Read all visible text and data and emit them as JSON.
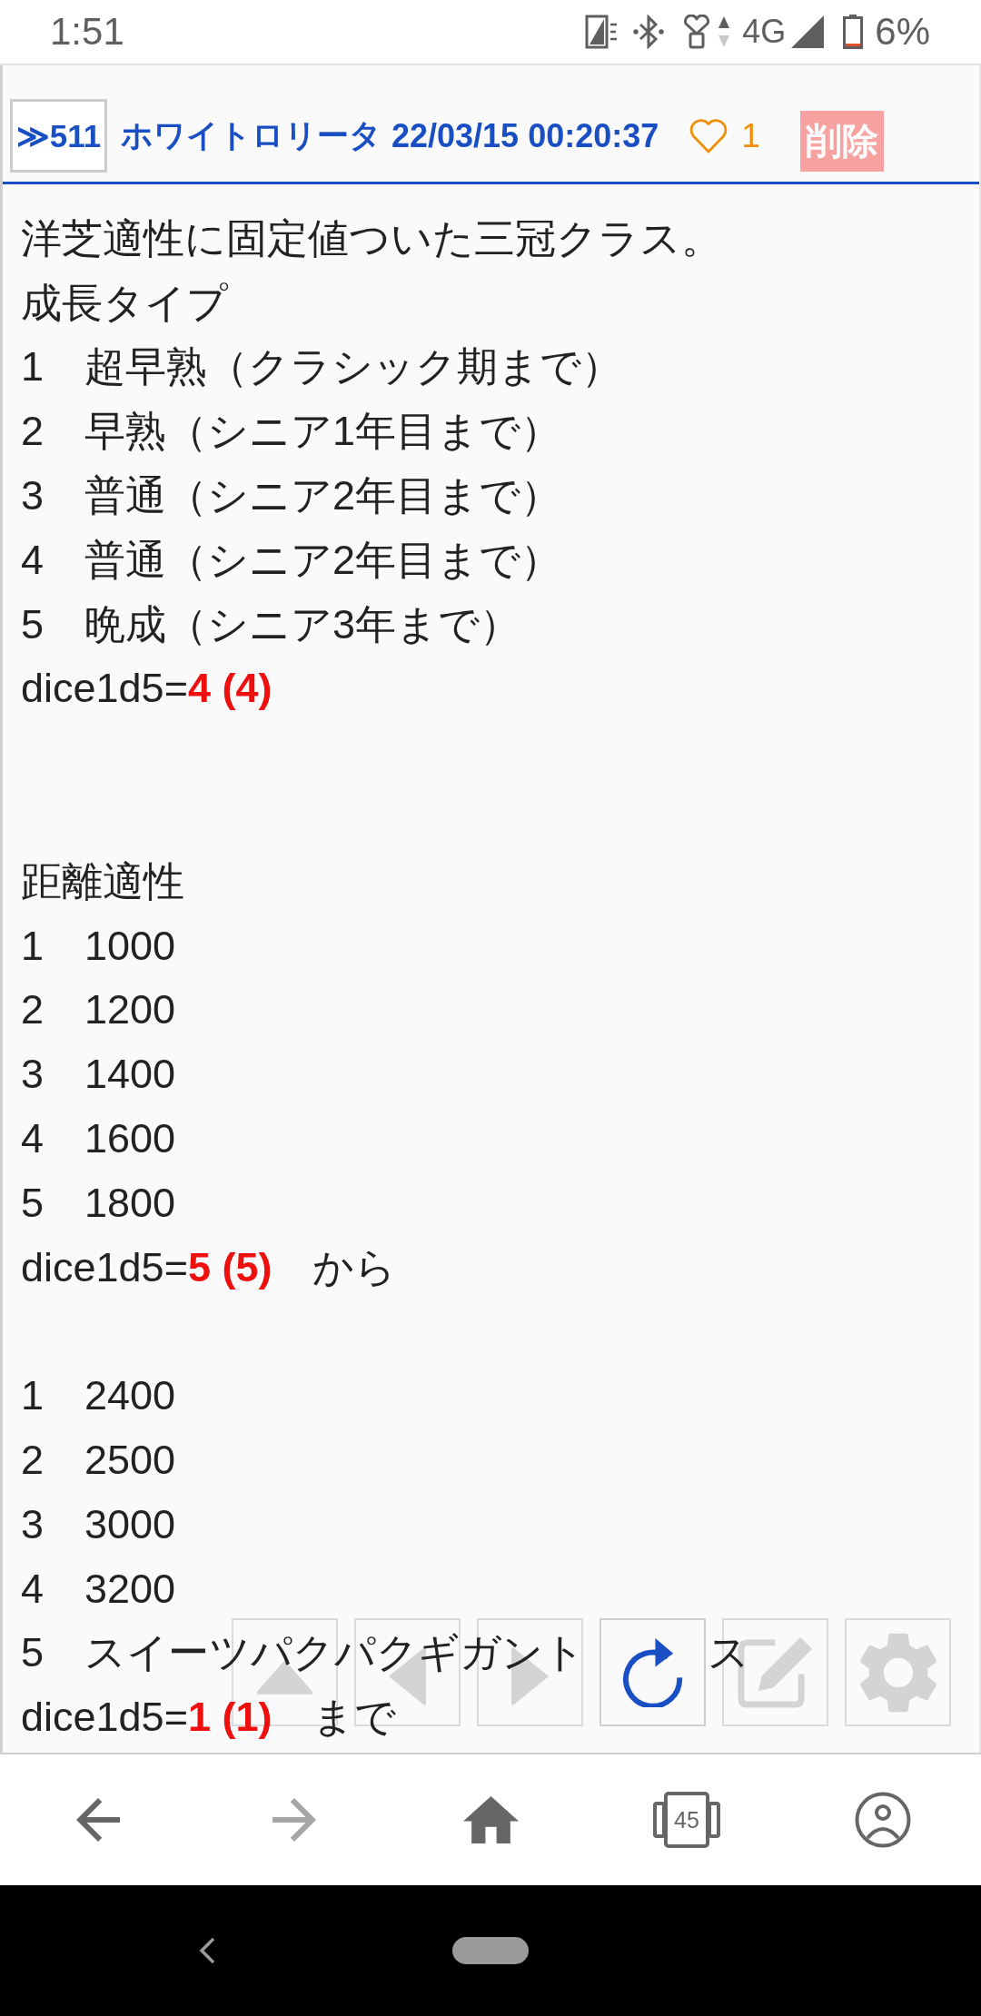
{
  "status_bar": {
    "time": "1:51",
    "network": "4G",
    "battery": "6%"
  },
  "post": {
    "anchor": "≫511",
    "author": "ホワイトロリータ",
    "timestamp": "22/03/15 00:20:37",
    "liked": false,
    "likes": "1",
    "delete_label": "削除",
    "lines": [
      {
        "kind": "text",
        "text": "洋芝適性に固定値ついた三冠クラス。"
      },
      {
        "kind": "text",
        "text": "成長タイプ"
      },
      {
        "kind": "text",
        "text": "1　超早熟（クラシック期まで）"
      },
      {
        "kind": "text",
        "text": "2　早熟（シニア1年目まで）"
      },
      {
        "kind": "text",
        "text": "3　普通（シニア2年目まで）"
      },
      {
        "kind": "text",
        "text": "4　普通（シニア2年目まで）"
      },
      {
        "kind": "text",
        "text": "5　晩成（シニア3年まで）"
      },
      {
        "kind": "dice",
        "expr": "dice1d5=",
        "result": "4 (4)"
      },
      {
        "kind": "blank"
      },
      {
        "kind": "blank"
      },
      {
        "kind": "text",
        "text": "距離適性"
      },
      {
        "kind": "text",
        "text": "1　1000"
      },
      {
        "kind": "text",
        "text": "2　1200"
      },
      {
        "kind": "text",
        "text": "3　1400"
      },
      {
        "kind": "text",
        "text": "4　1600"
      },
      {
        "kind": "text",
        "text": "5　1800"
      },
      {
        "kind": "dice",
        "expr": "dice1d5=",
        "result": "5 (5)",
        "suffix": "から"
      },
      {
        "kind": "blank"
      },
      {
        "kind": "text",
        "text": "1　2400"
      },
      {
        "kind": "text",
        "text": "2　2500"
      },
      {
        "kind": "text",
        "text": "3　3000"
      },
      {
        "kind": "text",
        "text": "4　3200"
      },
      {
        "kind": "covered",
        "text": "5　スイーツパクパクギガント",
        "tail": "ス"
      },
      {
        "kind": "dice",
        "expr": "dice1d5=",
        "result": "1 (1)",
        "suffix": "まで"
      }
    ]
  },
  "toolbar": [
    {
      "disabled": true
    },
    {
      "disabled": true
    },
    {
      "disabled": true
    },
    {
      "disabled": false
    },
    {
      "disabled": true
    },
    {
      "disabled": true
    }
  ],
  "bottom_nav": [
    {
      "disabled": false
    },
    {
      "disabled": true
    },
    {
      "disabled": false
    },
    {
      "count": "45",
      "disabled": false
    },
    {
      "disabled": false
    }
  ]
}
